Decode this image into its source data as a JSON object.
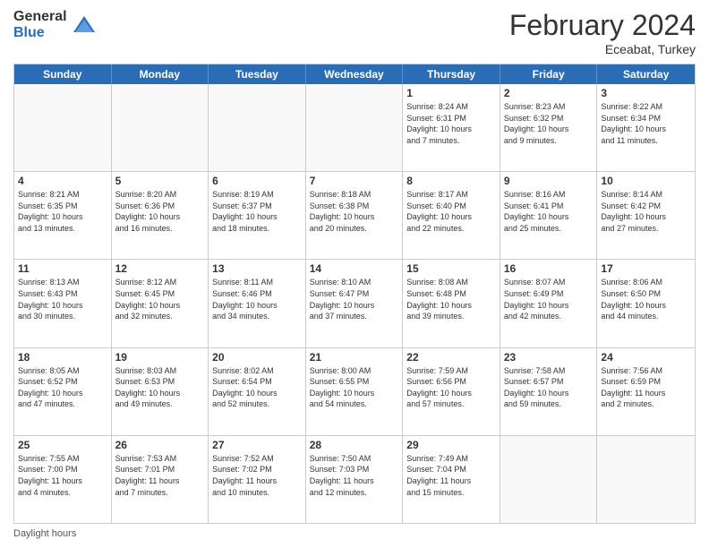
{
  "header": {
    "logo_general": "General",
    "logo_blue": "Blue",
    "month_title": "February 2024",
    "location": "Eceabat, Turkey"
  },
  "days_of_week": [
    "Sunday",
    "Monday",
    "Tuesday",
    "Wednesday",
    "Thursday",
    "Friday",
    "Saturday"
  ],
  "footer_text": "Daylight hours",
  "weeks": [
    [
      {
        "day": "",
        "info": ""
      },
      {
        "day": "",
        "info": ""
      },
      {
        "day": "",
        "info": ""
      },
      {
        "day": "",
        "info": ""
      },
      {
        "day": "1",
        "info": "Sunrise: 8:24 AM\nSunset: 6:31 PM\nDaylight: 10 hours\nand 7 minutes."
      },
      {
        "day": "2",
        "info": "Sunrise: 8:23 AM\nSunset: 6:32 PM\nDaylight: 10 hours\nand 9 minutes."
      },
      {
        "day": "3",
        "info": "Sunrise: 8:22 AM\nSunset: 6:34 PM\nDaylight: 10 hours\nand 11 minutes."
      }
    ],
    [
      {
        "day": "4",
        "info": "Sunrise: 8:21 AM\nSunset: 6:35 PM\nDaylight: 10 hours\nand 13 minutes."
      },
      {
        "day": "5",
        "info": "Sunrise: 8:20 AM\nSunset: 6:36 PM\nDaylight: 10 hours\nand 16 minutes."
      },
      {
        "day": "6",
        "info": "Sunrise: 8:19 AM\nSunset: 6:37 PM\nDaylight: 10 hours\nand 18 minutes."
      },
      {
        "day": "7",
        "info": "Sunrise: 8:18 AM\nSunset: 6:38 PM\nDaylight: 10 hours\nand 20 minutes."
      },
      {
        "day": "8",
        "info": "Sunrise: 8:17 AM\nSunset: 6:40 PM\nDaylight: 10 hours\nand 22 minutes."
      },
      {
        "day": "9",
        "info": "Sunrise: 8:16 AM\nSunset: 6:41 PM\nDaylight: 10 hours\nand 25 minutes."
      },
      {
        "day": "10",
        "info": "Sunrise: 8:14 AM\nSunset: 6:42 PM\nDaylight: 10 hours\nand 27 minutes."
      }
    ],
    [
      {
        "day": "11",
        "info": "Sunrise: 8:13 AM\nSunset: 6:43 PM\nDaylight: 10 hours\nand 30 minutes."
      },
      {
        "day": "12",
        "info": "Sunrise: 8:12 AM\nSunset: 6:45 PM\nDaylight: 10 hours\nand 32 minutes."
      },
      {
        "day": "13",
        "info": "Sunrise: 8:11 AM\nSunset: 6:46 PM\nDaylight: 10 hours\nand 34 minutes."
      },
      {
        "day": "14",
        "info": "Sunrise: 8:10 AM\nSunset: 6:47 PM\nDaylight: 10 hours\nand 37 minutes."
      },
      {
        "day": "15",
        "info": "Sunrise: 8:08 AM\nSunset: 6:48 PM\nDaylight: 10 hours\nand 39 minutes."
      },
      {
        "day": "16",
        "info": "Sunrise: 8:07 AM\nSunset: 6:49 PM\nDaylight: 10 hours\nand 42 minutes."
      },
      {
        "day": "17",
        "info": "Sunrise: 8:06 AM\nSunset: 6:50 PM\nDaylight: 10 hours\nand 44 minutes."
      }
    ],
    [
      {
        "day": "18",
        "info": "Sunrise: 8:05 AM\nSunset: 6:52 PM\nDaylight: 10 hours\nand 47 minutes."
      },
      {
        "day": "19",
        "info": "Sunrise: 8:03 AM\nSunset: 6:53 PM\nDaylight: 10 hours\nand 49 minutes."
      },
      {
        "day": "20",
        "info": "Sunrise: 8:02 AM\nSunset: 6:54 PM\nDaylight: 10 hours\nand 52 minutes."
      },
      {
        "day": "21",
        "info": "Sunrise: 8:00 AM\nSunset: 6:55 PM\nDaylight: 10 hours\nand 54 minutes."
      },
      {
        "day": "22",
        "info": "Sunrise: 7:59 AM\nSunset: 6:56 PM\nDaylight: 10 hours\nand 57 minutes."
      },
      {
        "day": "23",
        "info": "Sunrise: 7:58 AM\nSunset: 6:57 PM\nDaylight: 10 hours\nand 59 minutes."
      },
      {
        "day": "24",
        "info": "Sunrise: 7:56 AM\nSunset: 6:59 PM\nDaylight: 11 hours\nand 2 minutes."
      }
    ],
    [
      {
        "day": "25",
        "info": "Sunrise: 7:55 AM\nSunset: 7:00 PM\nDaylight: 11 hours\nand 4 minutes."
      },
      {
        "day": "26",
        "info": "Sunrise: 7:53 AM\nSunset: 7:01 PM\nDaylight: 11 hours\nand 7 minutes."
      },
      {
        "day": "27",
        "info": "Sunrise: 7:52 AM\nSunset: 7:02 PM\nDaylight: 11 hours\nand 10 minutes."
      },
      {
        "day": "28",
        "info": "Sunrise: 7:50 AM\nSunset: 7:03 PM\nDaylight: 11 hours\nand 12 minutes."
      },
      {
        "day": "29",
        "info": "Sunrise: 7:49 AM\nSunset: 7:04 PM\nDaylight: 11 hours\nand 15 minutes."
      },
      {
        "day": "",
        "info": ""
      },
      {
        "day": "",
        "info": ""
      }
    ]
  ]
}
